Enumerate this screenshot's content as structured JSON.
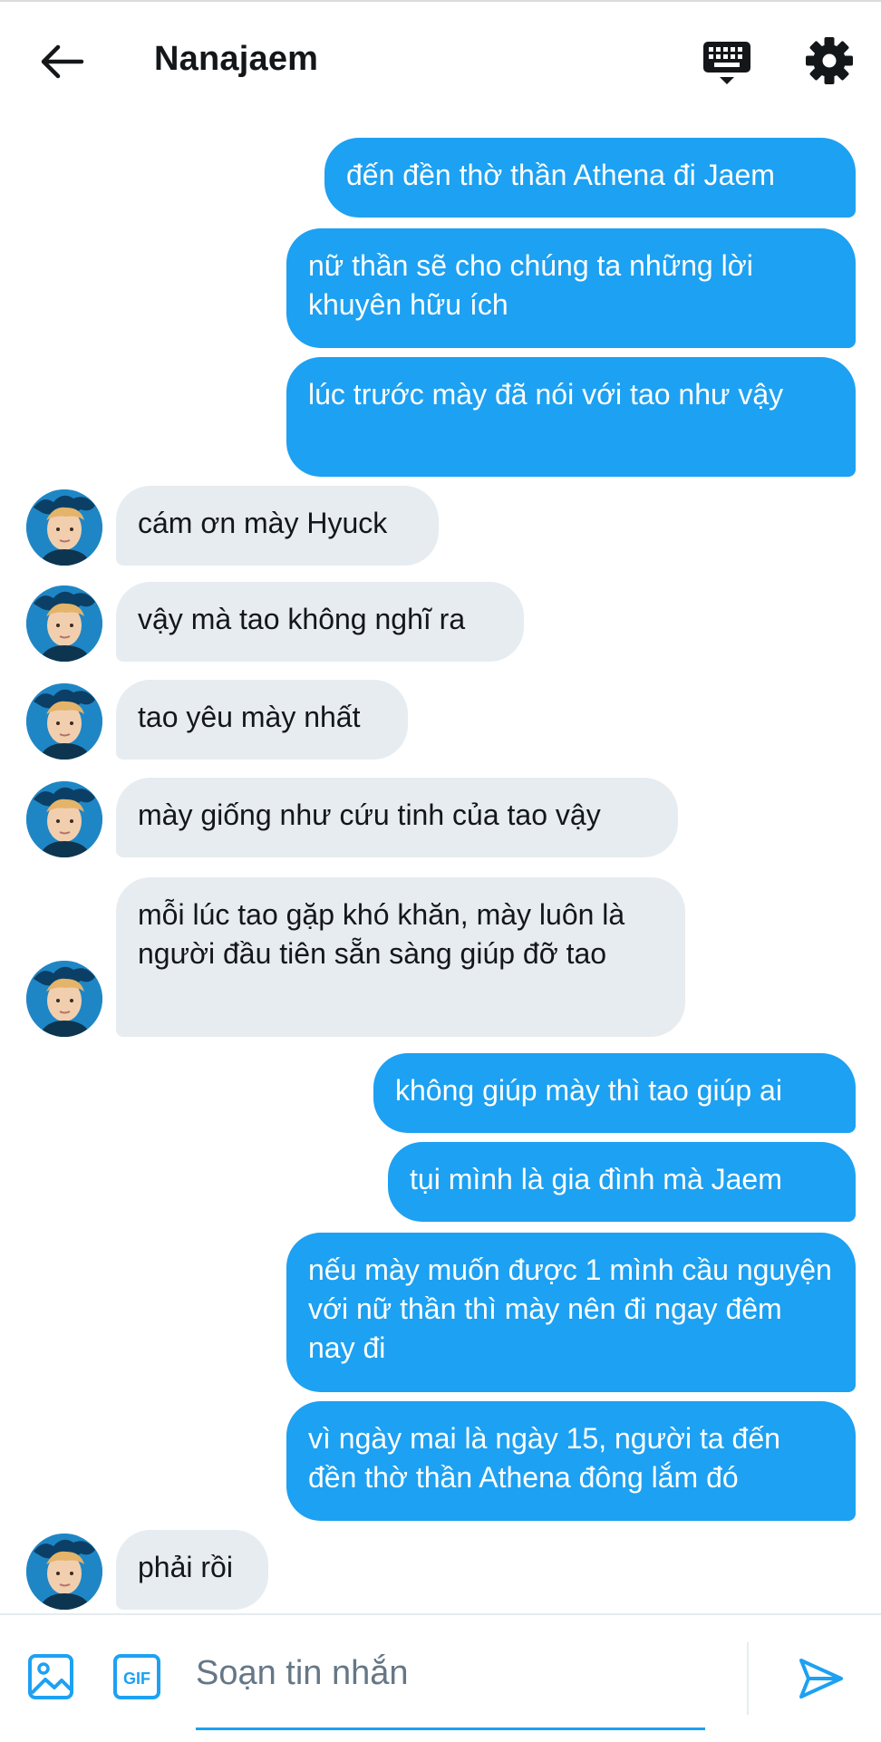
{
  "header": {
    "title": "Nanajaem",
    "back_icon": "arrow-left-icon",
    "keyboard_icon": "keyboard-icon",
    "settings_icon": "gear-icon"
  },
  "messages": [
    {
      "dir": "out",
      "text": "đến đền thờ thần Athena đi Jaem"
    },
    {
      "dir": "out",
      "text": "nữ thần sẽ cho chúng ta những lời khuyên hữu ích"
    },
    {
      "dir": "out",
      "text": "lúc trước mày đã nói với tao như vậy"
    },
    {
      "dir": "in",
      "text": "cám ơn mày Hyuck"
    },
    {
      "dir": "in",
      "text": "vậy mà tao không nghĩ ra"
    },
    {
      "dir": "in",
      "text": "tao yêu mày nhất"
    },
    {
      "dir": "in",
      "text": "mày giống như cứu tinh của tao vậy"
    },
    {
      "dir": "in",
      "text": "mỗi lúc tao gặp khó khăn, mày luôn là người đầu tiên sẵn sàng giúp đỡ tao"
    },
    {
      "dir": "out",
      "text": "không giúp mày thì tao giúp ai"
    },
    {
      "dir": "out",
      "text": "tụi mình là gia đình mà Jaem"
    },
    {
      "dir": "out",
      "text": "nếu mày muốn được 1 mình cầu nguyện với nữ thần thì mày nên đi ngay đêm nay đi"
    },
    {
      "dir": "out",
      "text": "vì ngày mai là ngày 15, người ta đến đền thờ thần Athena đông lắm đó"
    },
    {
      "dir": "in",
      "text": "phải rồi"
    }
  ],
  "composer": {
    "placeholder": "Soạn tin nhắn",
    "value": "",
    "image_icon": "image-icon",
    "gif_icon": "gif-icon",
    "send_icon": "send-icon"
  },
  "colors": {
    "outgoing_bubble": "#1da1f2",
    "incoming_bubble": "#e6ecf0",
    "accent": "#1da1f2"
  }
}
